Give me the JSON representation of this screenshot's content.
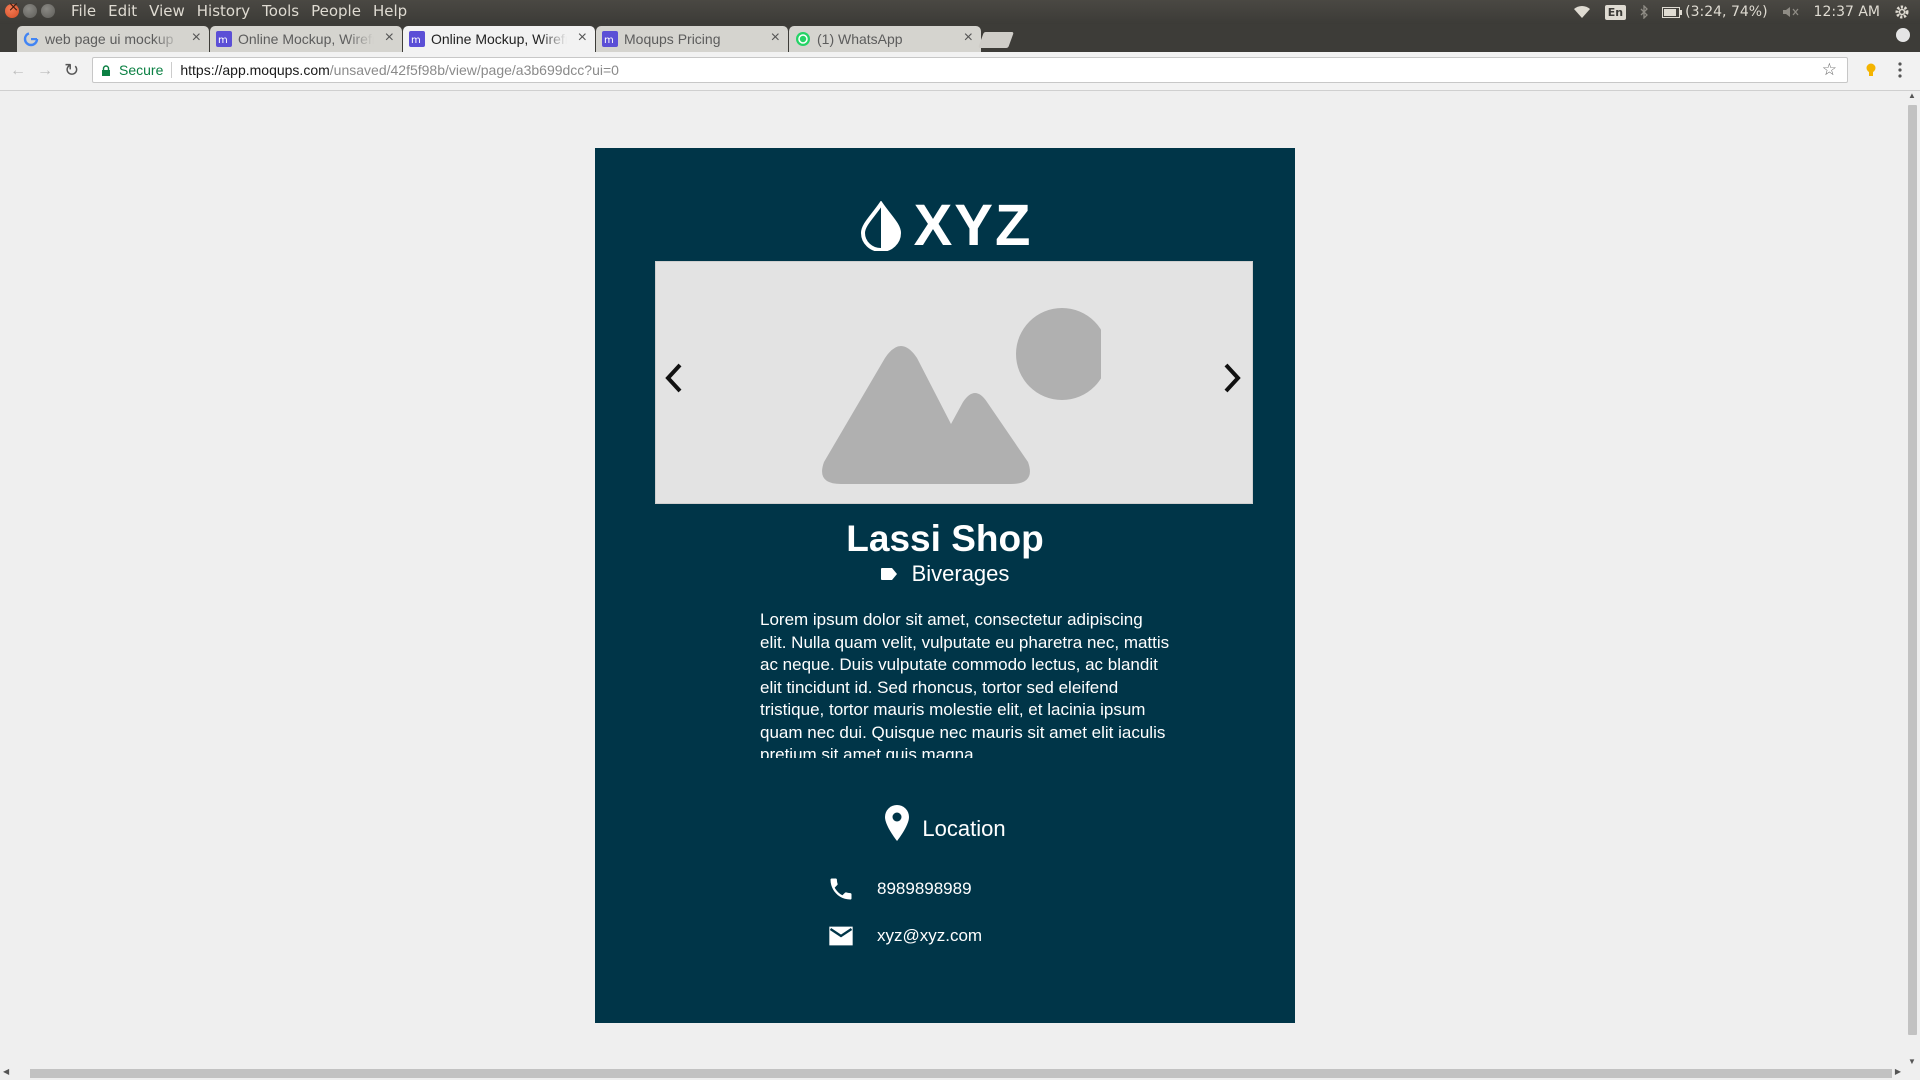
{
  "os_bar": {
    "menu": [
      "File",
      "Edit",
      "View",
      "History",
      "Tools",
      "People",
      "Help"
    ],
    "keyboard_layout": "En",
    "battery": "(3:24, 74%)",
    "clock": "12:37 AM"
  },
  "tabs": [
    {
      "title": "web page ui mockup",
      "favicon": "google-icon",
      "active": false
    },
    {
      "title": "Online Mockup, Wireframe",
      "favicon": "moqups-icon",
      "active": false
    },
    {
      "title": "Online Mockup, Wireframe",
      "favicon": "moqups-icon",
      "active": true
    },
    {
      "title": "Moqups Pricing",
      "favicon": "moqups-icon",
      "active": false
    },
    {
      "title": "(1) WhatsApp",
      "favicon": "whatsapp-icon",
      "active": false
    }
  ],
  "address_bar": {
    "security_label": "Secure",
    "url_host": "https://app.moqups.com",
    "url_path": "/unsaved/42f5f98b/view/page/a3b699dcc?ui=0"
  },
  "mockup": {
    "brand": "XYZ",
    "shop_name": "Lassi Shop",
    "category": "Biverages",
    "description": "Lorem ipsum dolor sit amet, consectetur adipiscing elit. Nulla quam velit, vulputate eu pharetra nec, mattis ac neque. Duis vulputate commodo lectus, ac blandit elit tincidunt id. Sed rhoncus, tortor sed eleifend tristique, tortor mauris molestie elit, et lacinia ipsum quam nec dui. Quisque nec mauris sit amet elit iaculis pretium sit amet quis magna.",
    "location_label": "Location",
    "phone": "8989898989",
    "email": "xyz@xyz.com"
  },
  "colors": {
    "card_background": "#003548",
    "secure_green": "#0b8043",
    "placeholder_gray": "#b0b0b0"
  }
}
